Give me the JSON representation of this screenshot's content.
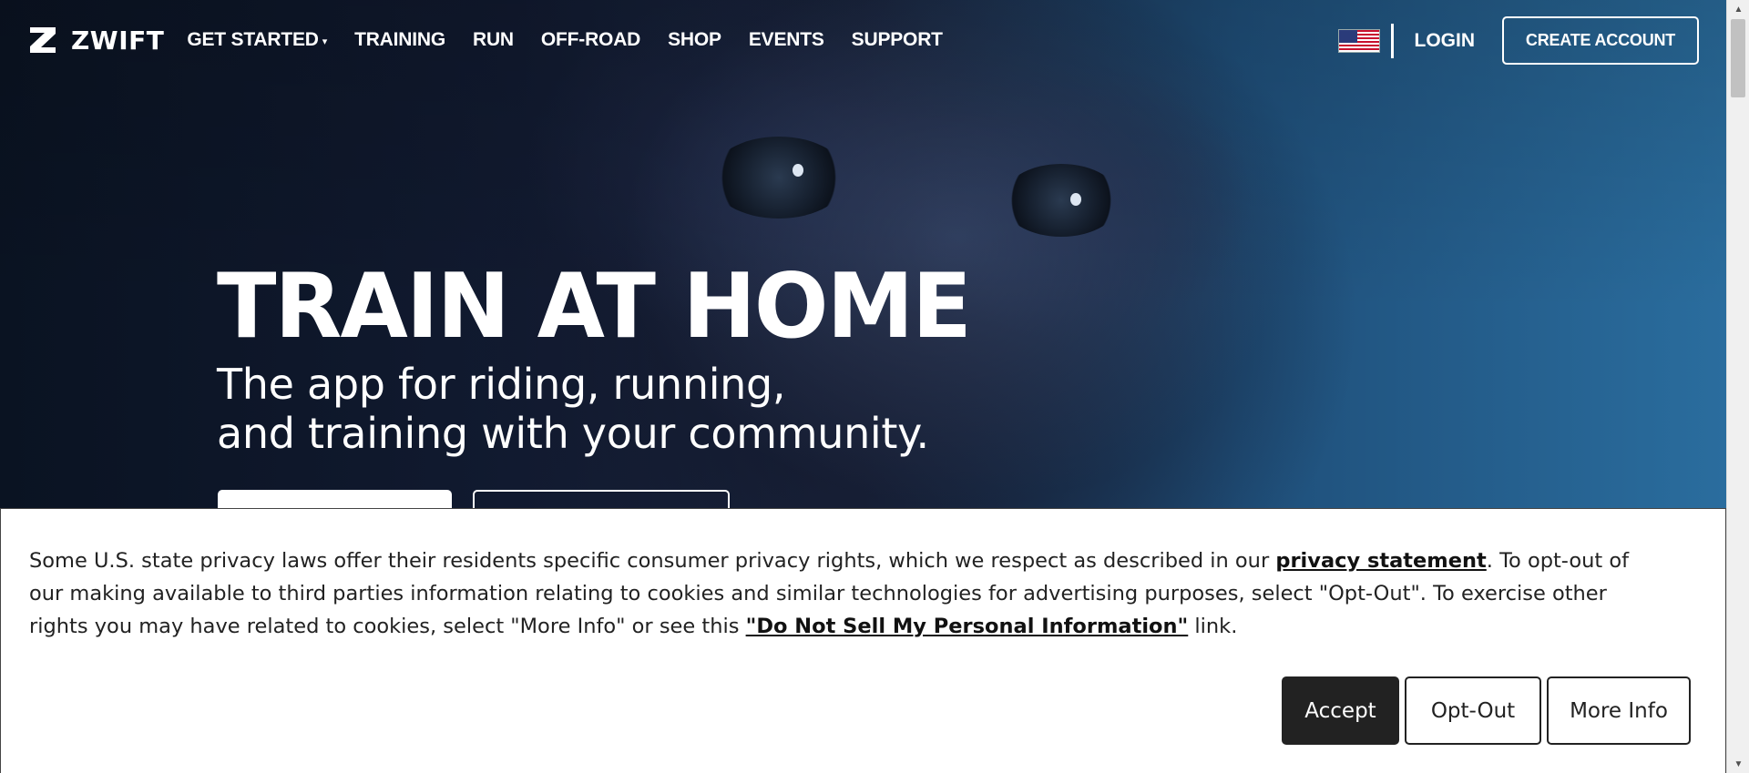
{
  "brand": {
    "name": "ZWIFT",
    "logo_icon": "zwift-z-logo"
  },
  "nav": {
    "items": [
      {
        "label": "GET STARTED",
        "has_dropdown": true
      },
      {
        "label": "TRAINING"
      },
      {
        "label": "RUN"
      },
      {
        "label": "OFF-ROAD"
      },
      {
        "label": "SHOP"
      },
      {
        "label": "EVENTS"
      },
      {
        "label": "SUPPORT"
      }
    ],
    "dropdown_icon": "▾",
    "locale_icon": "us-flag-icon",
    "login_label": "LOGIN",
    "create_account_label": "CREATE ACCOUNT"
  },
  "hero": {
    "title": "TRAIN AT HOME",
    "subtitle_line1": "The app for riding, running,",
    "subtitle_line2": "and training with your community."
  },
  "cookie_banner": {
    "text_part1": "Some U.S. state privacy laws offer their residents specific consumer privacy rights, which we respect as described in our ",
    "privacy_link": "privacy statement",
    "text_part2": ". To opt-out of our making available to third parties information relating to cookies and similar technologies for advertising purposes, select \"Opt-Out\". To exercise other rights you may have related to cookies, select \"More Info\" or see this ",
    "dnsmpi_link": "\"Do Not Sell My Personal Information\"",
    "text_part3": " link.",
    "accept_label": "Accept",
    "optout_label": "Opt-Out",
    "moreinfo_label": "More Info"
  },
  "colors": {
    "banner_bg": "#ffffff",
    "accept_bg": "#222222",
    "hero_blue": "#2a6d9e",
    "nav_text": "#ffffff"
  }
}
